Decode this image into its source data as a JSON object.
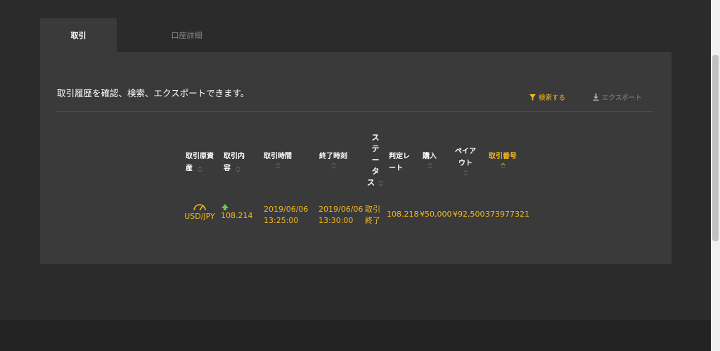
{
  "tabs": [
    {
      "label": "取引"
    },
    {
      "label": "口座詳細"
    }
  ],
  "panel": {
    "description": "取引履歴を確認、検索、エクスポートできます。",
    "search_label": "検索する",
    "export_label": "エクスポート"
  },
  "table": {
    "headers": [
      {
        "line1": "取引原資",
        "line2": "産"
      },
      {
        "line1": "取引内",
        "line2": "容"
      },
      {
        "line1": "取引時間",
        "line2": ""
      },
      {
        "line1": "終了時刻",
        "line2": ""
      },
      {
        "lines": [
          "ス",
          "テ",
          "ー",
          "タ",
          "ス"
        ]
      },
      {
        "line1": "判定レ",
        "line2": "ート"
      },
      {
        "line1": "購入",
        "line2": ""
      },
      {
        "line1": "ペイア",
        "line2": "ウト"
      },
      {
        "line1": "取引番号",
        "line2": ""
      }
    ],
    "row": {
      "asset": "USD/JPY",
      "content_value": "108.214",
      "trade_time_date": "2019/06/06",
      "trade_time_clock": "13:25:00",
      "end_time_date": "2019/06/06",
      "end_time_clock": "13:30:00",
      "status_line1": "取引",
      "status_line2": "終了",
      "judge_rate": "108.218",
      "purchase": "¥50,000",
      "payout": "¥92,500",
      "trade_number": "373977321"
    }
  },
  "colors": {
    "accent": "#f5b820",
    "background": "#2b2b2b",
    "panel": "#3a3a3a",
    "up_arrow": "#7bc24a"
  },
  "icons": {
    "filter": "filter-icon",
    "download": "download-icon",
    "gauge": "gauge-icon",
    "direction_up": "up-arrow-icon",
    "sort": "sort-chevron-icon"
  }
}
